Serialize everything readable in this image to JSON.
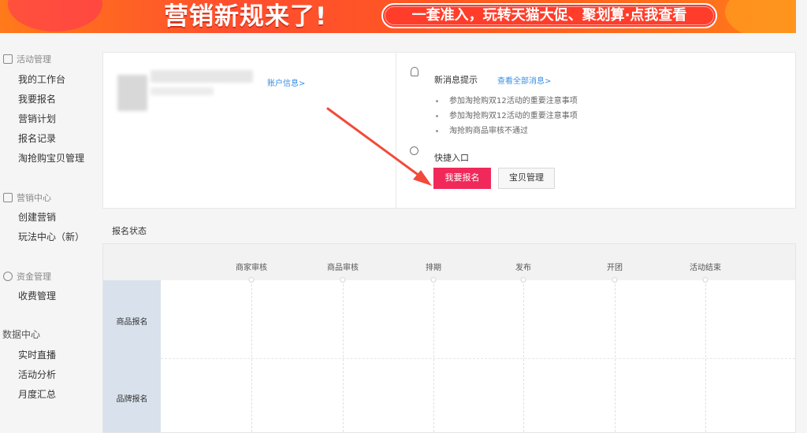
{
  "banner": {
    "headline": "营销新规来了!",
    "pill_text": "一套准入，玩转天猫大促、聚划算·点我查看"
  },
  "sidebar": {
    "groups": [
      {
        "title": "活动管理",
        "icon": "activity-icon",
        "items": [
          "我的工作台",
          "我要报名",
          "营销计划",
          "报名记录",
          "淘抢购宝贝管理"
        ]
      },
      {
        "title": "营销中心",
        "icon": "gift-icon",
        "items": [
          "创建营销",
          "玩法中心（新）"
        ]
      },
      {
        "title": "资金管理",
        "icon": "money-icon",
        "items": [
          "收费管理"
        ]
      },
      {
        "title": "数据中心",
        "items": [
          "实时直播",
          "活动分析",
          "月度汇总"
        ]
      }
    ]
  },
  "account": {
    "link": "账户信息>"
  },
  "messages": {
    "title": "新消息提示",
    "view_all": "查看全部消息>",
    "items": [
      "参加淘抢购双12活动的重要注意事项",
      "参加淘抢购双12活动的重要注意事项",
      "淘抢购商品审核不通过"
    ]
  },
  "quick": {
    "title": "快捷入口",
    "signup": "我要报名",
    "items_mgmt": "宝贝管理"
  },
  "status": {
    "title": "报名状态",
    "steps": [
      "商家审核",
      "商品审核",
      "排期",
      "发布",
      "开团",
      "活动结束"
    ],
    "rows": [
      "商品报名",
      "品牌报名"
    ]
  },
  "colors": {
    "accent": "#f0295a",
    "link": "#3a8ee6",
    "banner": "#ff4d2e"
  }
}
